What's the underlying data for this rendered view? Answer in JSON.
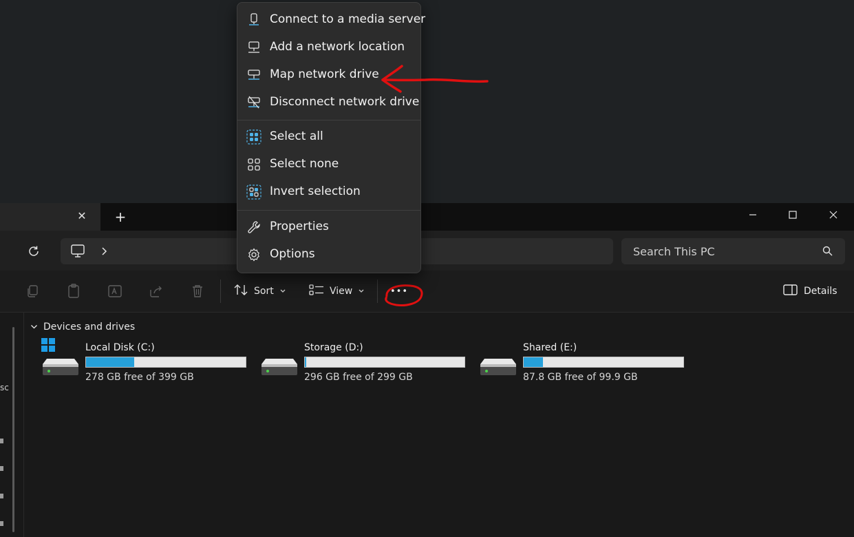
{
  "window": {
    "tab": {
      "close_icon": "close-icon"
    },
    "new_tab_icon": "plus-icon",
    "controls": [
      "minimize-icon",
      "maximize-icon",
      "close-icon"
    ]
  },
  "navbar": {
    "search_placeholder": "Search This PC"
  },
  "toolbar": {
    "sort_label": "Sort",
    "view_label": "View",
    "details_label": "Details",
    "more_glyph": "•••"
  },
  "sidebar": {
    "clipped_text": "sc"
  },
  "section": {
    "title": "Devices and drives"
  },
  "drives": [
    {
      "name": "Local Disk (C:)",
      "free_text": "278 GB free of 399 GB",
      "used_fraction": 0.3,
      "windows_logo": true
    },
    {
      "name": "Storage (D:)",
      "free_text": "296 GB free of 299 GB",
      "used_fraction": 0.01,
      "windows_logo": false
    },
    {
      "name": "Shared (E:)",
      "free_text": "87.8 GB free of 99.9 GB",
      "used_fraction": 0.12,
      "windows_logo": false
    }
  ],
  "menu": {
    "items": [
      {
        "label": "Connect to a media server",
        "icon": "media-server-icon"
      },
      {
        "label": "Add a network location",
        "icon": "network-location-icon"
      },
      {
        "label": "Map network drive",
        "icon": "map-drive-icon"
      },
      {
        "label": "Disconnect network drive",
        "icon": "disconnect-drive-icon"
      },
      {
        "label": "Select all",
        "icon": "select-all-icon"
      },
      {
        "label": "Select none",
        "icon": "select-none-icon"
      },
      {
        "label": "Invert selection",
        "icon": "invert-selection-icon"
      },
      {
        "label": "Properties",
        "icon": "wrench-icon"
      },
      {
        "label": "Options",
        "icon": "gear-icon"
      }
    ]
  },
  "colors": {
    "accent": "#26a0da",
    "annotation": "#e01010"
  }
}
